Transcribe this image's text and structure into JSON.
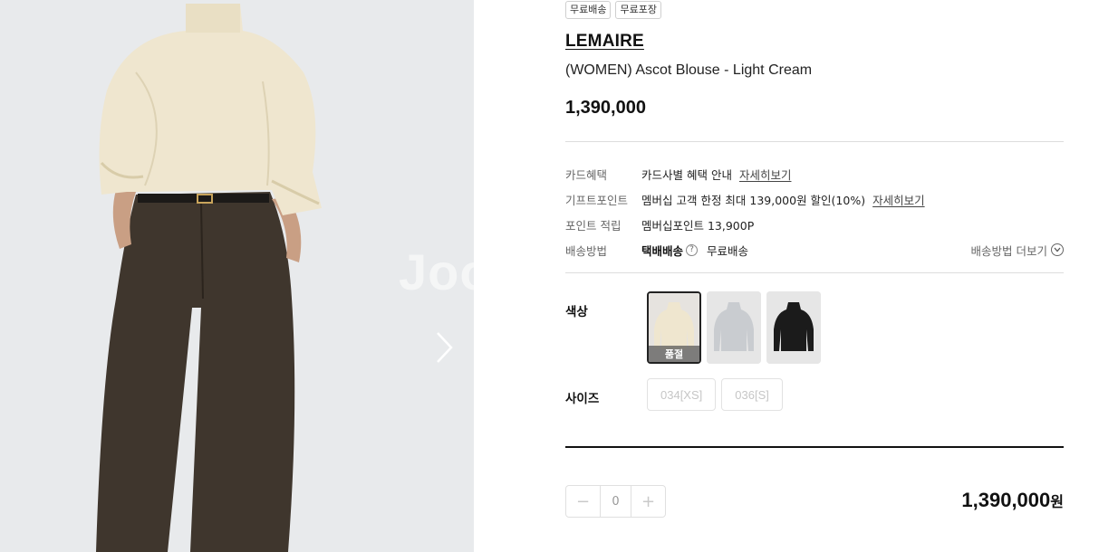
{
  "gallery": {
    "watermark_text": "Joo",
    "next_icon": "chevron-right-icon"
  },
  "product": {
    "badges": [
      "무료배송",
      "무료포장"
    ],
    "brand": "LEMAIRE",
    "name": "(WOMEN) Ascot Blouse - Light Cream",
    "price": "1,390,000"
  },
  "benefits": {
    "card": {
      "label": "카드혜택",
      "value": "카드사별 혜택 안내",
      "link": "자세히보기"
    },
    "gift_point": {
      "label": "기프트포인트",
      "value": "멤버십 고객 한정 최대 139,000원 할인(10%)",
      "link": "자세히보기"
    },
    "point": {
      "label": "포인트 적립",
      "value": "멤버십포인트 13,900P"
    },
    "shipping": {
      "label": "배송방법",
      "method": "택배배송",
      "help_icon": "question-icon",
      "fee": "무료배송",
      "more": "배송방법 더보기",
      "more_icon": "chevron-down-circle-icon"
    }
  },
  "options": {
    "color_label": "색상",
    "colors": [
      {
        "name": "light-cream",
        "swatch": "#efe6cf",
        "soldout": "품절",
        "selected": true
      },
      {
        "name": "light-grey",
        "swatch": "#c9ccd0",
        "selected": false
      },
      {
        "name": "black",
        "swatch": "#1b1b1b",
        "selected": false
      }
    ],
    "size_label": "사이즈",
    "sizes": [
      "034[XS]",
      "036[S]"
    ]
  },
  "purchase": {
    "qty_minus": "−",
    "qty_value": "0",
    "qty_plus": "+",
    "total_amount": "1,390,000",
    "total_unit": "원"
  }
}
